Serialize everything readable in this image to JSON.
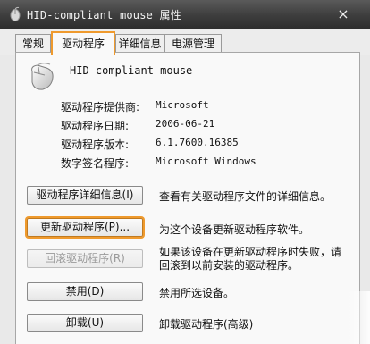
{
  "window": {
    "title": "HID-compliant mouse 属性",
    "close_symbol": "×"
  },
  "tabs": [
    {
      "label": "常规",
      "active": false
    },
    {
      "label": "驱动程序",
      "active": true
    },
    {
      "label": "详细信息",
      "active": false
    },
    {
      "label": "电源管理",
      "active": false
    }
  ],
  "device": {
    "name": "HID-compliant mouse",
    "icon": "mouse-icon"
  },
  "info": [
    {
      "label": "驱动程序提供商:",
      "value": "Microsoft"
    },
    {
      "label": "驱动程序日期:",
      "value": "2006-06-21"
    },
    {
      "label": "驱动程序版本:",
      "value": "6.1.7600.16385"
    },
    {
      "label": "数字签名程序:",
      "value": "Microsoft Windows"
    }
  ],
  "actions": [
    {
      "button": "驱动程序详细信息(I)",
      "desc": "查看有关驱动程序文件的详细信息。",
      "enabled": true,
      "highlighted": false
    },
    {
      "button": "更新驱动程序(P)...",
      "desc": "为这个设备更新驱动程序软件。",
      "enabled": true,
      "highlighted": true
    },
    {
      "button": "回滚驱动程序(R)",
      "desc": "如果该设备在更新驱动程序时失败，请回滚到以前安装的驱动程序。",
      "enabled": false,
      "highlighted": false
    },
    {
      "button": "禁用(D)",
      "desc": "禁用所选设备。",
      "enabled": true,
      "highlighted": false
    },
    {
      "button": "卸载(U)",
      "desc": "卸载驱动程序(高级)",
      "enabled": true,
      "highlighted": false
    }
  ],
  "colors": {
    "highlight": "#ef9a2d",
    "titlebar": "#3d3d3d"
  }
}
